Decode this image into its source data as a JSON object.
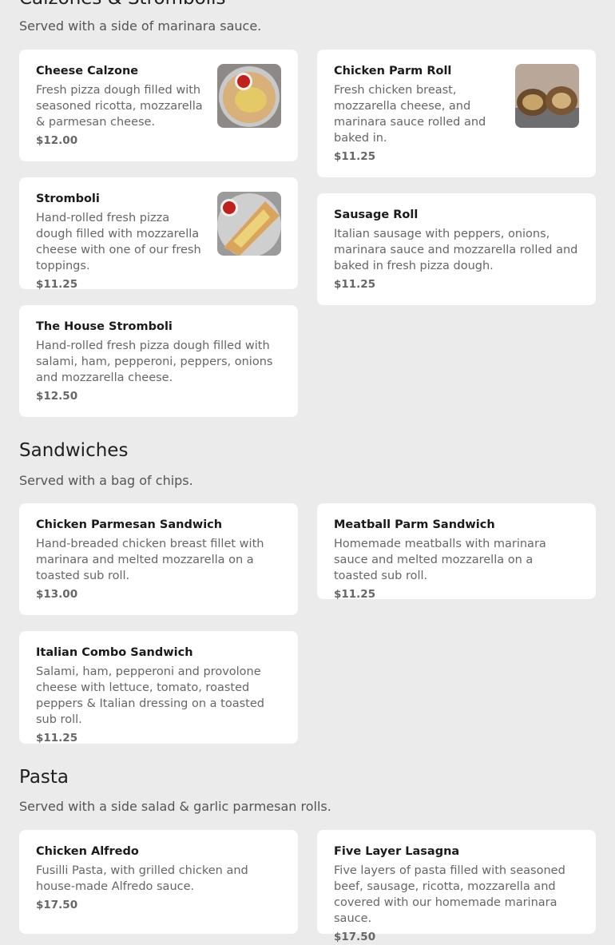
{
  "sections": [
    {
      "title": "Calzones & Strombolis",
      "subtitle": "Served with a side of marinara sauce.",
      "items": [
        {
          "name": "Cheese Calzone",
          "desc": "Fresh pizza dough filled with seasoned ricotta, mozzarella & parmesan cheese.",
          "price": "$12.00"
        },
        {
          "name": "Chicken Parm Roll",
          "desc": "Fresh chicken breast, mozzarella cheese, and marinara sauce rolled and baked in.",
          "price": "$11.25"
        },
        {
          "name": "Stromboli",
          "desc": "Hand-rolled fresh pizza dough filled with mozzarella cheese with one of our fresh toppings.",
          "price": "$11.25"
        },
        {
          "name": "Sausage Roll",
          "desc": "Italian sausage with peppers, onions, marinara sauce and mozzarella rolled and baked in fresh pizza dough.",
          "price": "$11.25"
        },
        {
          "name": "The House Stromboli",
          "desc": "Hand-rolled fresh pizza dough filled with salami, ham, pepperoni, peppers, onions and mozzarella cheese.",
          "price": "$12.50"
        }
      ]
    },
    {
      "title": "Sandwiches",
      "subtitle": "Served with a bag of chips.",
      "items": [
        {
          "name": "Chicken Parmesan Sandwich",
          "desc": "Hand-breaded chicken breast fillet with marinara and melted mozzarella on a toasted sub roll.",
          "price": "$13.00"
        },
        {
          "name": "Meatball Parm Sandwich",
          "desc": "Homemade meatballs with marinara sauce and melted mozzarella on a toasted sub roll.",
          "price": "$11.25"
        },
        {
          "name": "Italian Combo Sandwich",
          "desc": "Salami, ham, pepperoni and provolone cheese with lettuce, tomato, roasted peppers & Italian dressing on a toasted sub roll.",
          "price": "$11.25"
        }
      ]
    },
    {
      "title": "Pasta",
      "subtitle": "Served with a side salad & garlic parmesan rolls.",
      "items": [
        {
          "name": "Chicken Alfredo",
          "desc": "Fusilli Pasta, with grilled chicken and house-made Alfredo sauce.",
          "price": "$17.50"
        },
        {
          "name": "Five Layer Lasagna",
          "desc": "Five layers of pasta filled with seasoned beef, sausage, ricotta, mozzarella and covered with our homemade marinara sauce.",
          "price": "$17.50"
        }
      ]
    }
  ]
}
